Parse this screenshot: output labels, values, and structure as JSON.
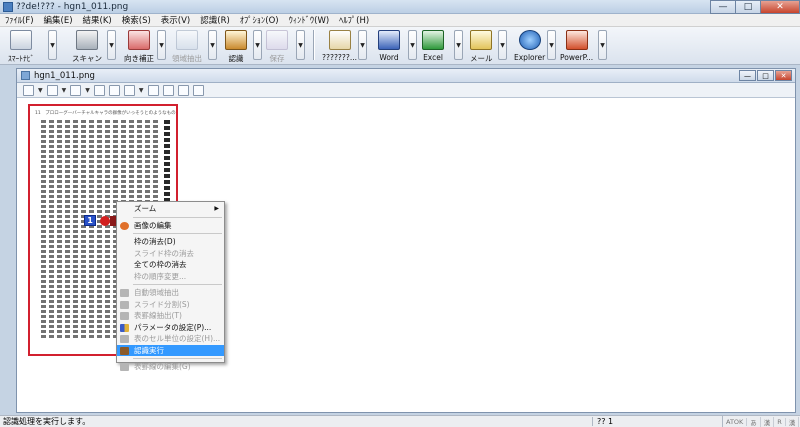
{
  "window": {
    "title": "??de!??? - hgn1_011.png",
    "minimize": "—",
    "maximize": "□",
    "close": "✕"
  },
  "menu": [
    "ﾌｧｲﾙ(F)",
    "編集(E)",
    "結果(K)",
    "検索(S)",
    "表示(V)",
    "認識(R)",
    "ｵﾌﾟｼｮﾝ(O)",
    "ｳｨﾝﾄﾞｳ(W)",
    "ﾍﾙﾌﾟ(H)"
  ],
  "toolbar": {
    "smart_navi": "ｽﾏｰﾄﾅﾋﾞ",
    "scan": "スキャン",
    "orientation": "向き補正",
    "area_extract": "領域抽出",
    "recognize": "認識",
    "save": "保存",
    "unknown": "???????...",
    "word": "Word",
    "excel": "Excel",
    "mail": "メール",
    "explorer": "Explorer",
    "powerpoint": "PowerP..."
  },
  "document": {
    "name": "hgn1_011.png",
    "header_text": "11　プロローグ―バーチャルキャラの群像がいっそうとのようなもの",
    "selection_number": "1"
  },
  "context_menu": {
    "zoom": "ズーム",
    "edit_image": "画像の編集",
    "delete_frame": "枠の消去(D)",
    "delete_slide_frame": "スライド枠の消去",
    "delete_all_frames": "全ての枠の消去",
    "change_frame_order": "枠の順序変更...",
    "auto_area_extract": "自動領域抽出",
    "slide_split": "スライド分割(S)",
    "table_line_extract": "表罫線抽出(T)",
    "parameter_settings": "パラメータの設定(P)...",
    "cell_unit_settings": "表のセル単位の設定(H)...",
    "run_recognition": "認識実行",
    "edit_table_lines": "表罫線の編集(G)"
  },
  "status": {
    "message": "認識処理を実行します。",
    "page": "?? 1",
    "ime": [
      "ATOK",
      "あ",
      "漢",
      "R",
      "漢"
    ]
  },
  "colors": {
    "accent": "#3399ff",
    "frame_red": "#d2202f",
    "selection_blue": "#2a52c9"
  }
}
